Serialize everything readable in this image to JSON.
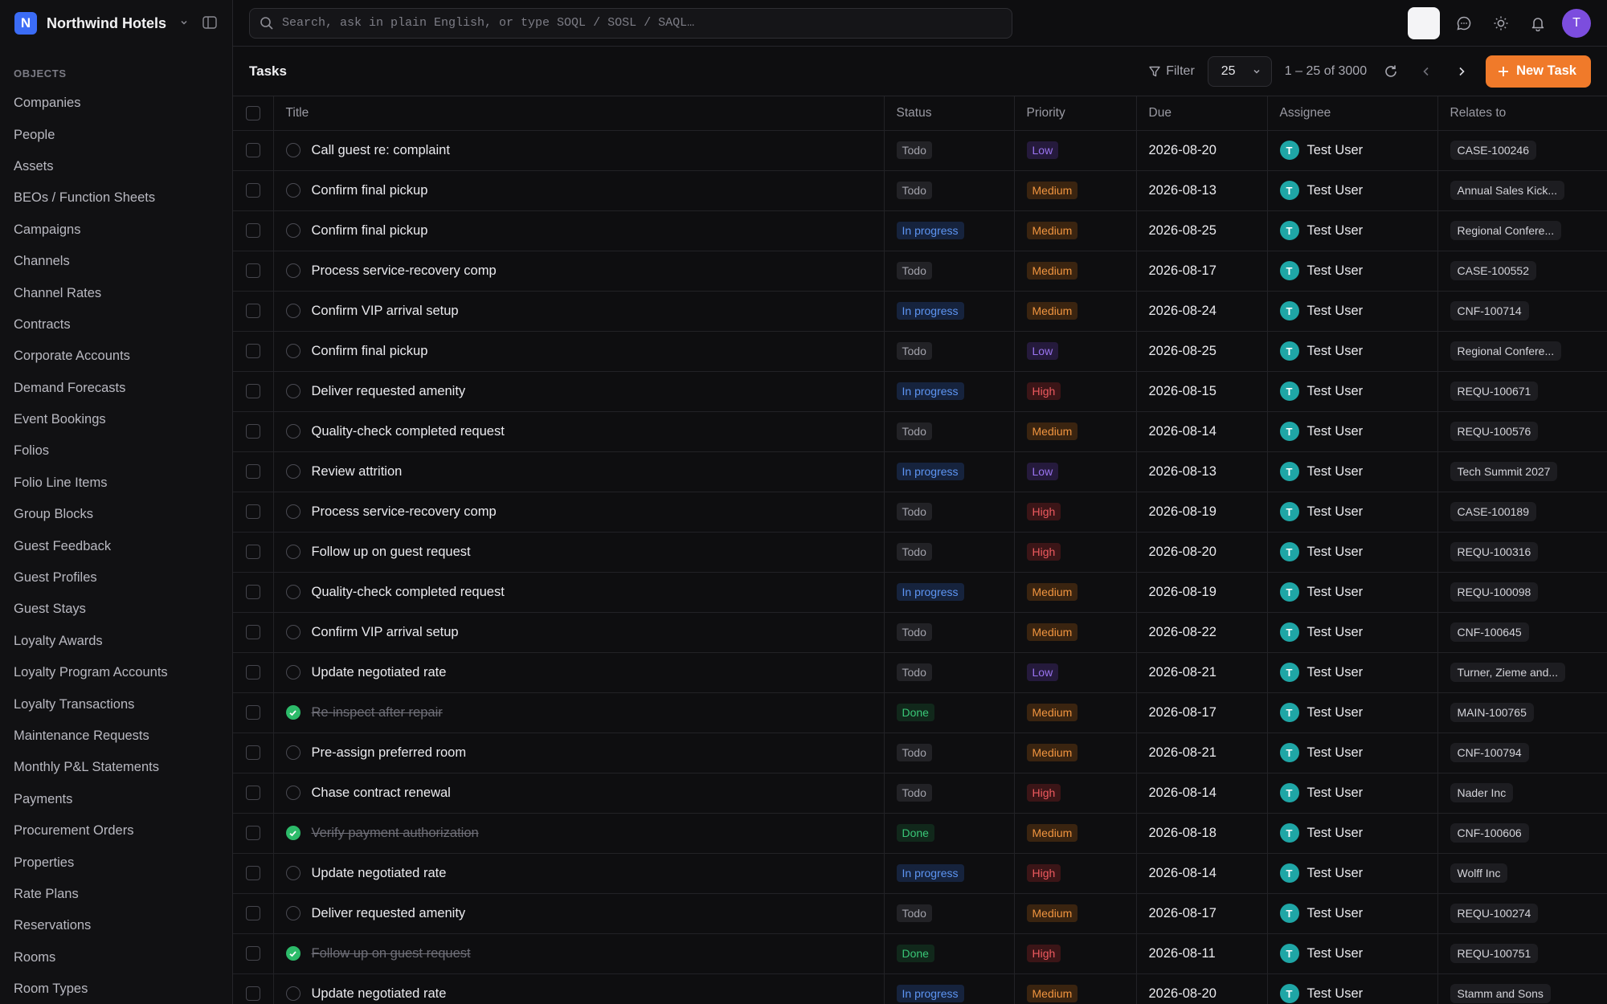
{
  "brand": {
    "initial": "N",
    "name": "Northwind Hotels"
  },
  "sidebar": {
    "section_label": "OBJECTS",
    "items": [
      "Companies",
      "People",
      "Assets",
      "BEOs / Function Sheets",
      "Campaigns",
      "Channels",
      "Channel Rates",
      "Contracts",
      "Corporate Accounts",
      "Demand Forecasts",
      "Event Bookings",
      "Folios",
      "Folio Line Items",
      "Group Blocks",
      "Guest Feedback",
      "Guest Profiles",
      "Guest Stays",
      "Loyalty Awards",
      "Loyalty Program Accounts",
      "Loyalty Transactions",
      "Maintenance Requests",
      "Monthly P&L Statements",
      "Payments",
      "Procurement Orders",
      "Properties",
      "Rate Plans",
      "Reservations",
      "Rooms",
      "Room Types"
    ]
  },
  "search": {
    "placeholder": "Search, ask in plain English, or type SOQL / SOSL / SAQL…"
  },
  "user": {
    "initial": "T"
  },
  "toolbar": {
    "title": "Tasks",
    "filter_label": "Filter",
    "page_size": "25",
    "range": "1 – 25 of 3000",
    "new_task_label": "New Task"
  },
  "table": {
    "columns": {
      "title": "Title",
      "status": "Status",
      "priority": "Priority",
      "due": "Due",
      "assignee": "Assignee",
      "relates": "Relates to"
    },
    "rows": [
      {
        "title": "Call guest re: complaint",
        "status": "Todo",
        "priority": "Low",
        "due": "2026-08-20",
        "assignee": "Test User",
        "relates": "CASE-100246",
        "done": false
      },
      {
        "title": "Confirm final pickup",
        "status": "Todo",
        "priority": "Medium",
        "due": "2026-08-13",
        "assignee": "Test User",
        "relates": "Annual Sales Kick...",
        "done": false
      },
      {
        "title": "Confirm final pickup",
        "status": "In progress",
        "priority": "Medium",
        "due": "2026-08-25",
        "assignee": "Test User",
        "relates": "Regional Confere...",
        "done": false
      },
      {
        "title": "Process service-recovery comp",
        "status": "Todo",
        "priority": "Medium",
        "due": "2026-08-17",
        "assignee": "Test User",
        "relates": "CASE-100552",
        "done": false
      },
      {
        "title": "Confirm VIP arrival setup",
        "status": "In progress",
        "priority": "Medium",
        "due": "2026-08-24",
        "assignee": "Test User",
        "relates": "CNF-100714",
        "done": false
      },
      {
        "title": "Confirm final pickup",
        "status": "Todo",
        "priority": "Low",
        "due": "2026-08-25",
        "assignee": "Test User",
        "relates": "Regional Confere...",
        "done": false
      },
      {
        "title": "Deliver requested amenity",
        "status": "In progress",
        "priority": "High",
        "due": "2026-08-15",
        "assignee": "Test User",
        "relates": "REQU-100671",
        "done": false
      },
      {
        "title": "Quality-check completed request",
        "status": "Todo",
        "priority": "Medium",
        "due": "2026-08-14",
        "assignee": "Test User",
        "relates": "REQU-100576",
        "done": false
      },
      {
        "title": "Review attrition",
        "status": "In progress",
        "priority": "Low",
        "due": "2026-08-13",
        "assignee": "Test User",
        "relates": "Tech Summit 2027",
        "done": false
      },
      {
        "title": "Process service-recovery comp",
        "status": "Todo",
        "priority": "High",
        "due": "2026-08-19",
        "assignee": "Test User",
        "relates": "CASE-100189",
        "done": false
      },
      {
        "title": "Follow up on guest request",
        "status": "Todo",
        "priority": "High",
        "due": "2026-08-20",
        "assignee": "Test User",
        "relates": "REQU-100316",
        "done": false
      },
      {
        "title": "Quality-check completed request",
        "status": "In progress",
        "priority": "Medium",
        "due": "2026-08-19",
        "assignee": "Test User",
        "relates": "REQU-100098",
        "done": false
      },
      {
        "title": "Confirm VIP arrival setup",
        "status": "Todo",
        "priority": "Medium",
        "due": "2026-08-22",
        "assignee": "Test User",
        "relates": "CNF-100645",
        "done": false
      },
      {
        "title": "Update negotiated rate",
        "status": "Todo",
        "priority": "Low",
        "due": "2026-08-21",
        "assignee": "Test User",
        "relates": "Turner, Zieme and...",
        "done": false
      },
      {
        "title": "Re-inspect after repair",
        "status": "Done",
        "priority": "Medium",
        "due": "2026-08-17",
        "assignee": "Test User",
        "relates": "MAIN-100765",
        "done": true
      },
      {
        "title": "Pre-assign preferred room",
        "status": "Todo",
        "priority": "Medium",
        "due": "2026-08-21",
        "assignee": "Test User",
        "relates": "CNF-100794",
        "done": false
      },
      {
        "title": "Chase contract renewal",
        "status": "Todo",
        "priority": "High",
        "due": "2026-08-14",
        "assignee": "Test User",
        "relates": "Nader Inc",
        "done": false
      },
      {
        "title": "Verify payment authorization",
        "status": "Done",
        "priority": "Medium",
        "due": "2026-08-18",
        "assignee": "Test User",
        "relates": "CNF-100606",
        "done": true
      },
      {
        "title": "Update negotiated rate",
        "status": "In progress",
        "priority": "High",
        "due": "2026-08-14",
        "assignee": "Test User",
        "relates": "Wolff Inc",
        "done": false
      },
      {
        "title": "Deliver requested amenity",
        "status": "Todo",
        "priority": "Medium",
        "due": "2026-08-17",
        "assignee": "Test User",
        "relates": "REQU-100274",
        "done": false
      },
      {
        "title": "Follow up on guest request",
        "status": "Done",
        "priority": "High",
        "due": "2026-08-11",
        "assignee": "Test User",
        "relates": "REQU-100751",
        "done": true
      },
      {
        "title": "Update negotiated rate",
        "status": "In progress",
        "priority": "Medium",
        "due": "2026-08-20",
        "assignee": "Test User",
        "relates": "Stamm and Sons",
        "done": false
      }
    ]
  },
  "colors": {
    "accent": "#f07a2a",
    "brand": "#3b6cf6",
    "avatar": "#1fa6a6"
  }
}
